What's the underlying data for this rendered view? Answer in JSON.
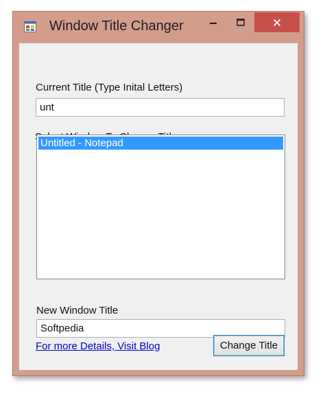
{
  "window": {
    "title": "Window Title Changer",
    "controls": {
      "minimize": "–",
      "maximize": "□",
      "close": "✕"
    },
    "app_icon": "app-window-icon"
  },
  "form": {
    "current_title_label": "Current Title (Type Inital Letters)",
    "current_title_value": "unt",
    "select_window_label": "Select Window To Change Title",
    "window_list": [
      {
        "label": "Untitled - Notepad",
        "selected": true
      }
    ],
    "new_title_label": "New Window Title",
    "new_title_value": "Softpedia",
    "blog_link": "For more Details, Visit Blog",
    "change_button": "Change Title"
  },
  "colors": {
    "frame": "#d39d8c",
    "close_button": "#c74f4a",
    "selection": "#3399ff",
    "link": "#0000cc"
  }
}
